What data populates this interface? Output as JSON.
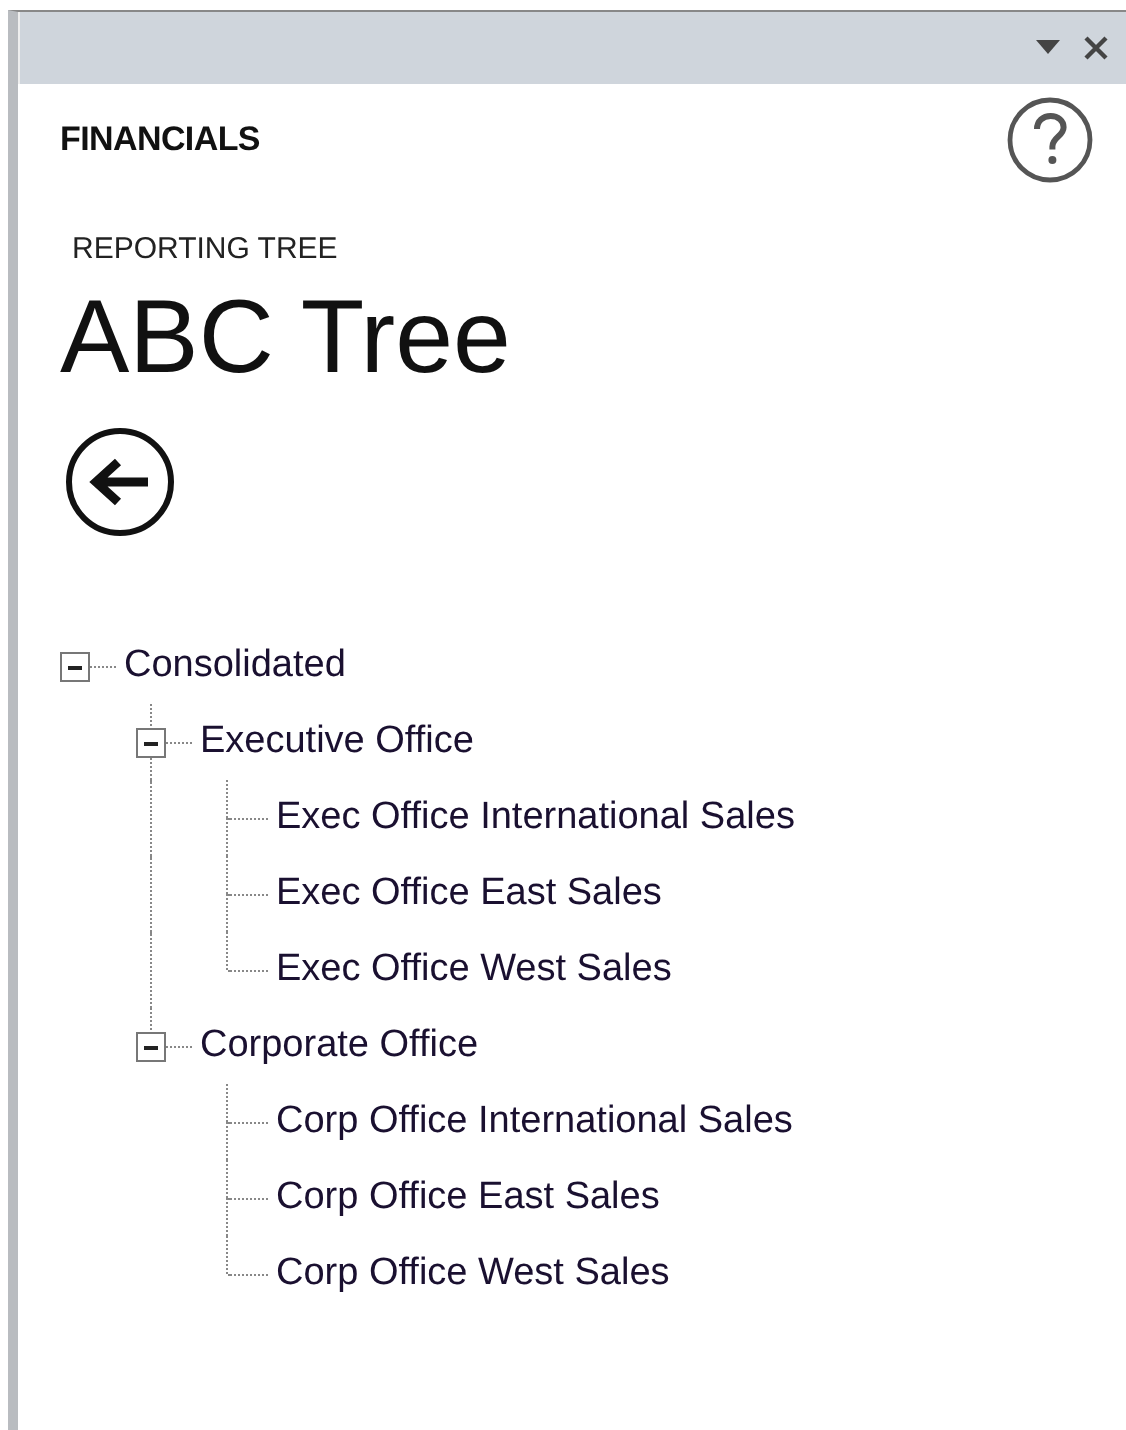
{
  "pane": {
    "title": "FINANCIALS"
  },
  "section_label": "REPORTING TREE",
  "tree_name": "ABC Tree",
  "tree": [
    {
      "label": "Consolidated",
      "expanded": true,
      "children": [
        {
          "label": "Executive Office",
          "expanded": true,
          "children": [
            {
              "label": "Exec Office International Sales"
            },
            {
              "label": "Exec Office East Sales"
            },
            {
              "label": "Exec Office West Sales"
            }
          ]
        },
        {
          "label": "Corporate Office",
          "expanded": true,
          "children": [
            {
              "label": "Corp Office International Sales"
            },
            {
              "label": "Corp Office East Sales"
            },
            {
              "label": "Corp Office West Sales"
            }
          ]
        }
      ]
    }
  ]
}
